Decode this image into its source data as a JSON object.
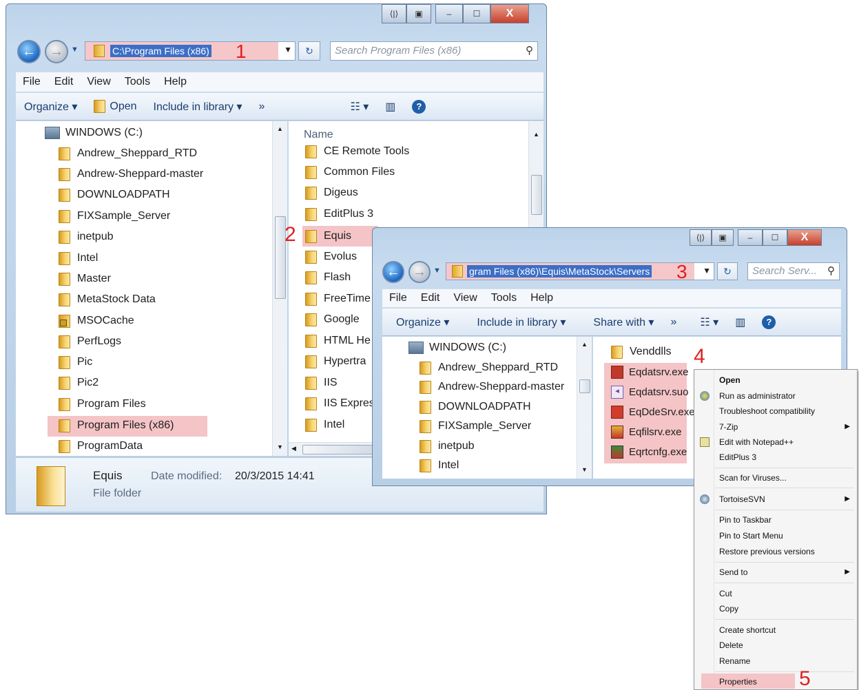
{
  "window1": {
    "caption_buttons": [
      "⟨|⟩",
      "▣",
      "–",
      "☐",
      "X"
    ],
    "address": "C:\\Program Files (x86)",
    "annotation": "1",
    "search_placeholder": "Search Program Files (x86)",
    "menu": [
      "File",
      "Edit",
      "View",
      "Tools",
      "Help"
    ],
    "toolbar": {
      "organize": "Organize ▾",
      "open": "Open",
      "include": "Include in library ▾",
      "more": "»"
    },
    "tree": [
      {
        "label": "WINDOWS (C:)",
        "icon": "drive-icon"
      },
      {
        "label": "Andrew_Sheppard_RTD",
        "icon": "folder-icon"
      },
      {
        "label": "Andrew-Sheppard-master",
        "icon": "folder-icon"
      },
      {
        "label": "DOWNLOADPATH",
        "icon": "folder-icon"
      },
      {
        "label": "FIXSample_Server",
        "icon": "folder-icon"
      },
      {
        "label": "inetpub",
        "icon": "folder-icon"
      },
      {
        "label": "Intel",
        "icon": "folder-icon"
      },
      {
        "label": "Master",
        "icon": "folder-icon"
      },
      {
        "label": "MetaStock Data",
        "icon": "folder-icon"
      },
      {
        "label": "MSOCache",
        "icon": "locked-folder-icon"
      },
      {
        "label": "PerfLogs",
        "icon": "folder-icon"
      },
      {
        "label": "Pic",
        "icon": "folder-icon"
      },
      {
        "label": "Pic2",
        "icon": "folder-icon"
      },
      {
        "label": "Program Files",
        "icon": "folder-icon"
      },
      {
        "label": "Program Files (x86)",
        "icon": "folder-icon",
        "selected": true
      },
      {
        "label": "ProgramData",
        "icon": "folder-icon"
      }
    ],
    "list_header": "Name",
    "files": [
      "CE Remote Tools",
      "Common Files",
      "Digeus",
      "EditPlus 3",
      "Equis",
      "Evolus",
      "Flash",
      "FreeTime",
      "Google",
      "HTML He",
      "Hypertra",
      "IIS",
      "IIS Expres",
      "Intel"
    ],
    "equis_annotation": "2",
    "status": {
      "name": "Equis",
      "date_label": "Date modified:",
      "date": "20/3/2015 14:41",
      "type": "File folder"
    }
  },
  "window2": {
    "address": "gram Files (x86)\\Equis\\MetaStock\\Servers",
    "annotation": "3",
    "search_placeholder": "Search Serv...",
    "menu": [
      "File",
      "Edit",
      "View",
      "Tools",
      "Help"
    ],
    "toolbar": {
      "organize": "Organize ▾",
      "include": "Include in library ▾",
      "share": "Share with ▾",
      "more": "»"
    },
    "tree": [
      "WINDOWS (C:)",
      "Andrew_Sheppard_RTD",
      "Andrew-Sheppard-master",
      "DOWNLOADPATH",
      "FIXSample_Server",
      "inetpub",
      "Intel"
    ],
    "files": [
      "Venddlls",
      "Eqdatsrv.exe",
      "Eqdatsrv.suo",
      "EqDdeSrv.exe",
      "Eqfilsrv.exe",
      "Eqrtcnfg.exe"
    ],
    "files_annotation": "4"
  },
  "context_menu": {
    "items": [
      {
        "label": "Open",
        "bold": true
      },
      {
        "label": "Run as administrator"
      },
      {
        "label": "Troubleshoot compatibility"
      },
      {
        "label": "7-Zip",
        "submenu": true
      },
      {
        "label": "Edit with Notepad++"
      },
      {
        "label": "EditPlus 3"
      },
      {
        "label": "Scan for Viruses..."
      },
      {
        "label": "TortoiseSVN",
        "submenu": true
      },
      {
        "label": "Pin to Taskbar"
      },
      {
        "label": "Pin to Start Menu"
      },
      {
        "label": "Restore previous versions"
      },
      {
        "label": "Send to",
        "submenu": true
      },
      {
        "label": "Cut"
      },
      {
        "label": "Copy"
      },
      {
        "label": "Create shortcut"
      },
      {
        "label": "Delete"
      },
      {
        "label": "Rename"
      },
      {
        "label": "Properties"
      }
    ],
    "annotation": "5"
  }
}
